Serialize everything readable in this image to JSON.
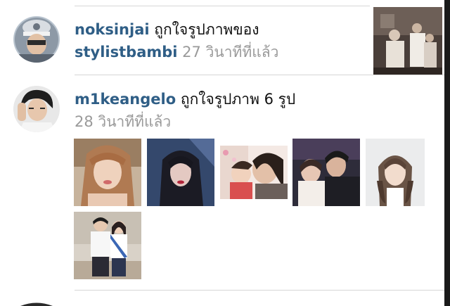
{
  "feed": {
    "items": [
      {
        "username": "noksinjai",
        "action": "ถูกใจรูปภาพของ",
        "target_user": "stylistbambi",
        "time": "27 วินาทีที่แล้ว"
      },
      {
        "username": "m1keangelo",
        "action": "ถูกใจรูปภาพ 6 รูป",
        "time": "28 วินาทีที่แล้ว"
      }
    ]
  },
  "colors": {
    "username": "#2f5e86",
    "action_text": "#111111",
    "timestamp": "#9a9a9a",
    "divider": "#d6d6d6"
  }
}
